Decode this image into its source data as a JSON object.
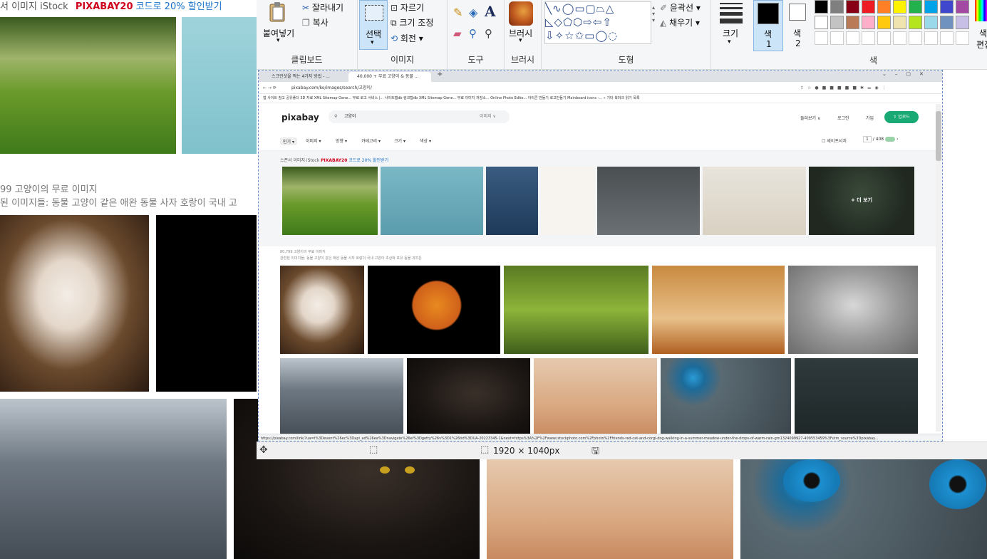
{
  "background": {
    "banner_prefix": "서 이미지 iStock",
    "promo_code": "PIXABAY20",
    "promo_suffix": "코드로 20% 할인받기",
    "result_count": "99 고양이의 무료 이미지",
    "related": "된 이미지들:  동물 고양이 같은 애완 동물 사자 호랑이 국내 고"
  },
  "ribbon": {
    "clipboard": {
      "paste": "붙여넣기",
      "cut": "잘라내기",
      "copy": "복사",
      "label": "클립보드"
    },
    "image": {
      "select": "선택",
      "crop": "자르기",
      "resize": "크기 조정",
      "rotate": "회전",
      "label": "이미지"
    },
    "tools": {
      "label": "도구"
    },
    "brush": {
      "label": "브러시"
    },
    "shapes": {
      "outline": "윤곽선",
      "fill": "채우기",
      "label": "도형"
    },
    "size": {
      "label": "크기"
    },
    "color1": {
      "label": "색",
      "num": "1"
    },
    "color2": {
      "label": "색",
      "num": "2"
    },
    "colors": {
      "label": "색",
      "edit_fragment1": "색",
      "edit_fragment2": "편집"
    },
    "palette": [
      "#000000",
      "#7f7f7f",
      "#880015",
      "#ed1c24",
      "#ff7f27",
      "#fff200",
      "#22b14c",
      "#00a2e8",
      "#3f48cc",
      "#a349a4",
      "#ffffff",
      "#c3c3c3",
      "#b97a57",
      "#ffaec9",
      "#ffc90e",
      "#efe4b0",
      "#b5e61d",
      "#99d9ea",
      "#7092be",
      "#c8bfe7"
    ]
  },
  "browser": {
    "tabs": [
      {
        "title": "스크린샷을 찍는 4가지 방법 - ..."
      },
      {
        "title": "40,000 + 무료 고양이 & 동물 ..."
      }
    ],
    "new_tab": "+",
    "url": "pixabay.com/ko/images/search/고양이/",
    "bookmarks": "앱  사이트 참고  공유폴더  3D 자료  XML Sitemap Gene...  무료 로고 서비스 |...  사이트맵db  링크탑db  XML Sitemap Gene...  무료 이미지 저장소...  Online Photo Edito...  아이콘 만들기  로고만들기  Mainboard icons -...  »  기타 북마크  읽기 목록"
  },
  "pixabay": {
    "logo": "pixabay",
    "search_value": "고양이",
    "search_type": "이미지 ∨",
    "nav": {
      "explore": "둘러보기 ∨",
      "login": "로그인",
      "join": "가입",
      "upload": "⇧ 업로드"
    },
    "filters": [
      "인기 ▾",
      "이미지 ▾",
      "방향 ▾",
      "카테고리 ▾",
      "크기 ▾",
      "색상 ▾"
    ],
    "safesearch": "세이프서치",
    "page_current": "1",
    "page_total": "/ 408",
    "banner_label": "스폰서 이미지 iStock",
    "banner_code": "PIXABAY20",
    "banner_suffix": "코드로 20% 할인받기",
    "more": "+ 더 보기",
    "count": "80,799 고양이의 무료 이미지",
    "related": "관련된 이미지들:  동물 고양이 같은 애완 동물 사자 호랑이 국내 고양이 초상화 포유 동물 귀여운",
    "status_url": "https://pixabay.com/link/?ua=t%3Devent%26ec%3Dapi_ad%26ea%3Dnavigate%26el%3Dgetty%26v%3D1%26tid%3DUA-20223345-1&next=https%3A%2F%2Fwww.istockphoto.com%2Fphoto%2Ffriends-red-cat-and-corgi-dog-walking-in-a-summer-meadow-under-the-drops-of-warm-rain-gm1324099927-409553459%3Futm_source%3Dpixabay..."
  },
  "paint_status": {
    "dimensions": "1920 × 1040px"
  }
}
